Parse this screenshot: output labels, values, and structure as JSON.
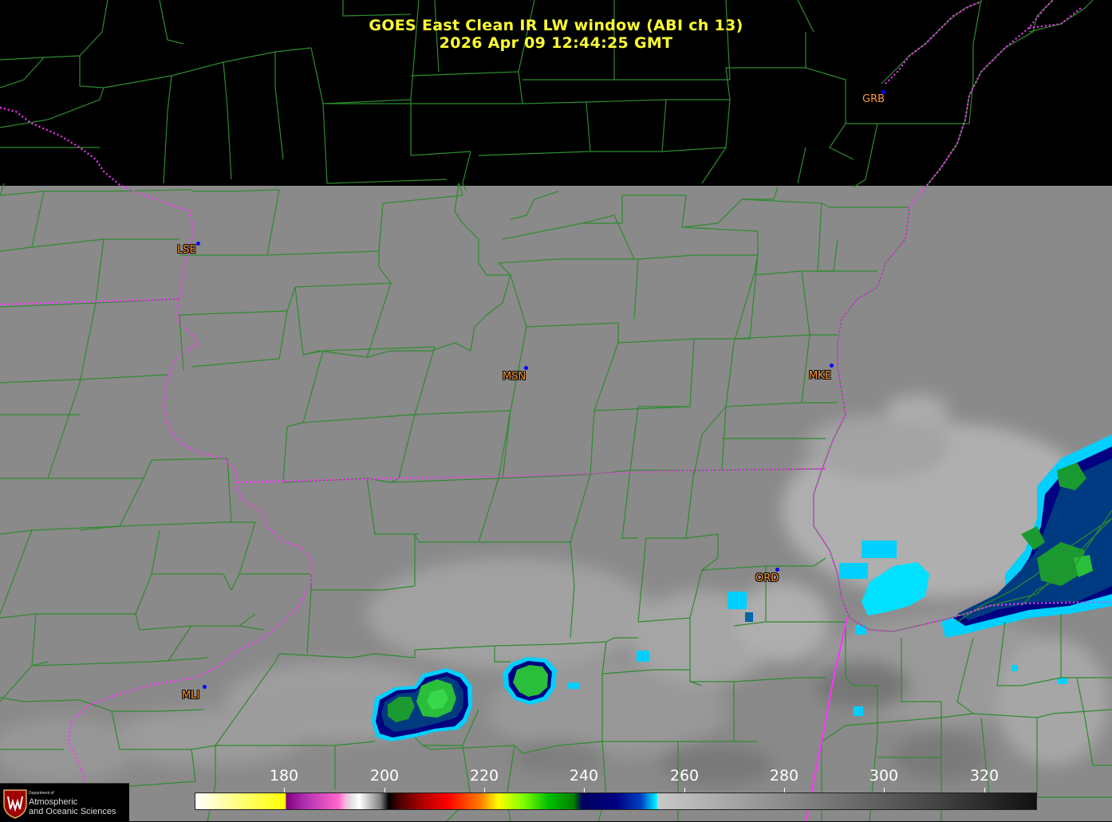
{
  "title": {
    "line1": "GOES East Clean IR LW window (ABI ch 13)",
    "line2": "2026 Apr 09  12:44:25 GMT"
  },
  "stations": [
    {
      "id": "GRB",
      "outlined": false
    },
    {
      "id": "LSE",
      "outlined": true
    },
    {
      "id": "MSN",
      "outlined": true
    },
    {
      "id": "MKE",
      "outlined": true
    },
    {
      "id": "ORD",
      "outlined": true
    },
    {
      "id": "MLI",
      "outlined": true
    }
  ],
  "colorbar": {
    "tick_labels": [
      "180",
      "200",
      "220",
      "240",
      "260",
      "280",
      "300",
      "320"
    ],
    "min_value": 163,
    "max_value": 330
  },
  "logo": {
    "small_text": "Department of",
    "line1": "Atmospheric",
    "line2": "and Oceanic Sciences"
  },
  "colors": {
    "title": "#ffff33",
    "county_lines": "#2e8b2e",
    "state_lines": "#ff33ff",
    "station_label": "#ff9933",
    "station_dot": "#0000ff",
    "no_data": "#000000",
    "background_ir": "#8a8a8a"
  }
}
